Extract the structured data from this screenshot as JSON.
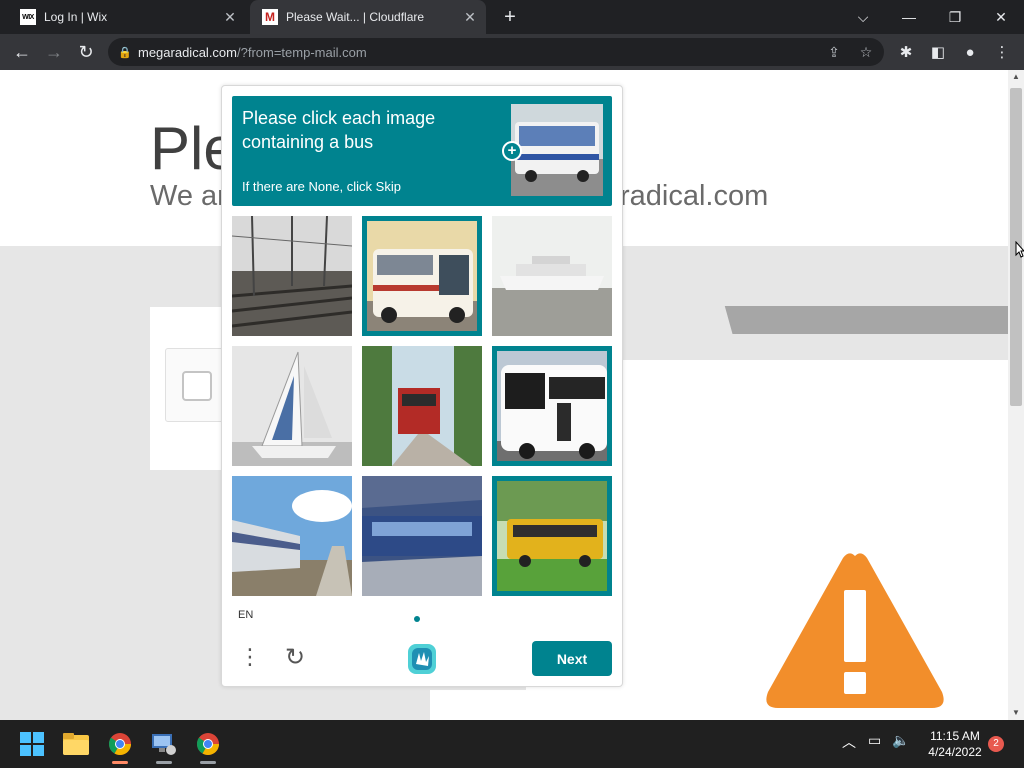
{
  "browser": {
    "tabs": [
      {
        "title": "Log In | Wix",
        "favicon": "WIX",
        "active": false
      },
      {
        "title": "Please Wait... | Cloudflare",
        "favicon": "M",
        "active": true
      }
    ],
    "new_tab_label": "+",
    "url_host": "megaradical.com",
    "url_path": "/?from=temp-mail.com",
    "toolbar_icons": [
      "share-icon",
      "star-icon",
      "extensions-icon",
      "sidepanel-icon",
      "profile-icon",
      "menu-icon"
    ]
  },
  "page": {
    "title_partial": "Ple",
    "subtitle_partial": "We ar",
    "subtitle_tail": "radical.com",
    "warning_color": "#f28e2b"
  },
  "captcha": {
    "prompt_line1": "Please click each image containing a bus",
    "prompt_sub": "If there are None, click Skip",
    "accent_color": "#00838f",
    "language": "EN",
    "next_label": "Next",
    "tiles": [
      {
        "content": "railway tracks",
        "selected": false
      },
      {
        "content": "bus",
        "selected": true
      },
      {
        "content": "ship",
        "selected": false
      },
      {
        "content": "sailboat",
        "selected": false
      },
      {
        "content": "train",
        "selected": false
      },
      {
        "content": "bus",
        "selected": true
      },
      {
        "content": "train",
        "selected": false
      },
      {
        "content": "train station",
        "selected": false
      },
      {
        "content": "school bus",
        "selected": true
      }
    ]
  },
  "taskbar": {
    "apps": [
      "windows-start",
      "file-explorer",
      "chrome",
      "remote-desktop",
      "chrome"
    ],
    "time": "11:15 AM",
    "date": "4/24/2022",
    "notification_count": "2"
  }
}
